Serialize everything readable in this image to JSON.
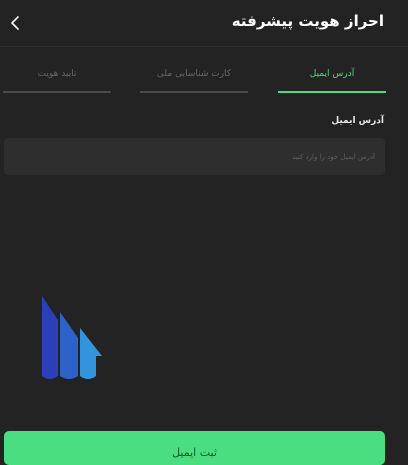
{
  "header": {
    "title": "احراز هویت پیشرفته",
    "back_icon": "chevron-left-icon"
  },
  "tabs": [
    {
      "label": "آدرس ایمیل",
      "active": true
    },
    {
      "label": "کارت شناسایی ملی",
      "active": false
    },
    {
      "label": "تایید هویت",
      "active": false
    }
  ],
  "form": {
    "email_label": "آدرس ایمیل",
    "email_placeholder": "آدرس ایمیل خود را وارد کنید",
    "email_value": ""
  },
  "logo_icon": "brand-logo-icon",
  "submit_label": "ثبت ایمیل",
  "colors": {
    "accent": "#4ade80",
    "background": "#232323",
    "input_background": "#2e2e2e",
    "inactive_text": "#676767"
  }
}
